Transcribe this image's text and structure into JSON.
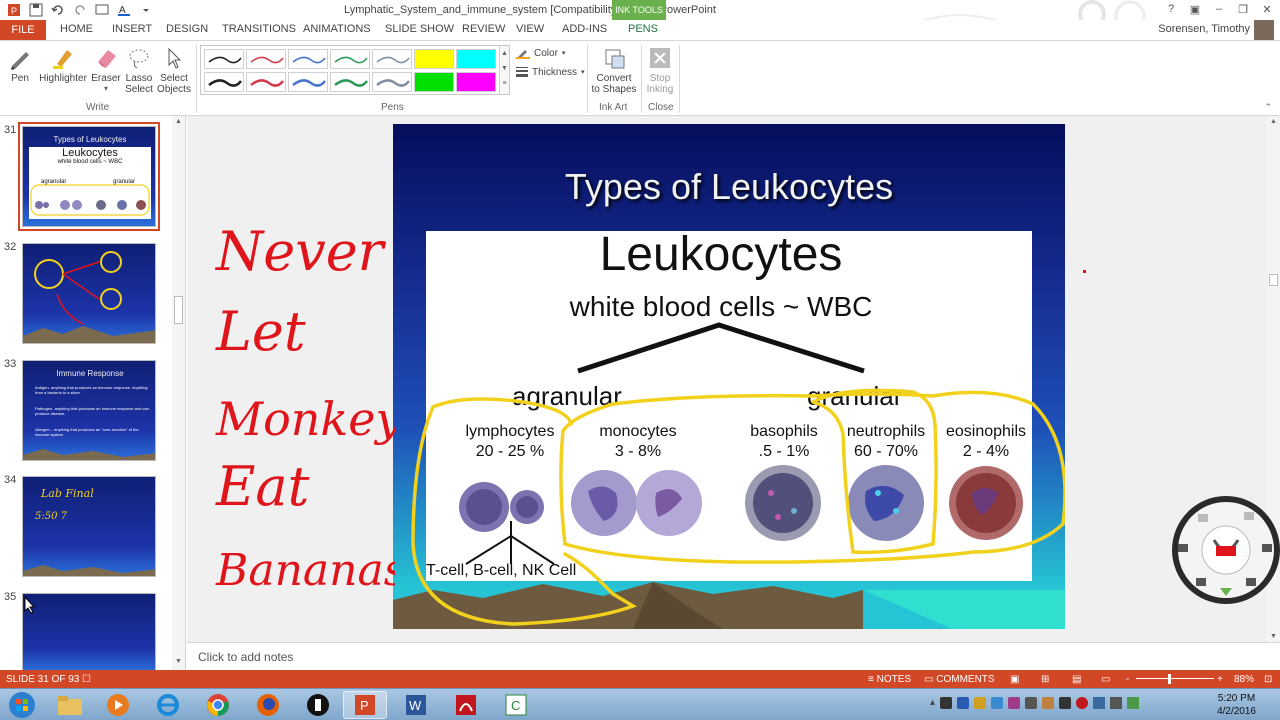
{
  "window": {
    "title": "Lymphatic_System_and_immune_system [Compatibility Mode] - PowerPoint",
    "context_tab_header": "INK TOOLS",
    "user": "Sorensen, Timothy"
  },
  "tabs": [
    "FILE",
    "HOME",
    "INSERT",
    "DESIGN",
    "TRANSITIONS",
    "ANIMATIONS",
    "SLIDE SHOW",
    "REVIEW",
    "VIEW",
    "ADD-INS",
    "PENS"
  ],
  "ribbon": {
    "write": {
      "label": "Write",
      "pen": "Pen",
      "highlighter": "Highlighter",
      "eraser": "Eraser",
      "lasso_1": "Lasso",
      "lasso_2": "Select",
      "select_1": "Select",
      "select_2": "Objects"
    },
    "pens": {
      "label": "Pens",
      "color": "Color",
      "thickness": "Thickness",
      "swatch_colors": [
        "#222222",
        "#d23a4a",
        "#4a74c9",
        "#2d9a5a",
        "#7f8f9f",
        "#ffff00",
        "#00ffff",
        "#222222",
        "#d23a4a",
        "#4a74c9",
        "#2d9a5a",
        "#7f8f9f",
        "#00e000",
        "#ff00ff"
      ]
    },
    "ink_art": {
      "label": "Ink Art",
      "convert_1": "Convert",
      "convert_2": "to Shapes"
    },
    "close": {
      "label": "Close",
      "stop_1": "Stop",
      "stop_2": "Inking"
    }
  },
  "thumbnails": {
    "numbers": [
      "31",
      "32",
      "33",
      "34",
      "35"
    ],
    "t31": {
      "title": "Types of Leukocytes",
      "big": "Leukocytes",
      "sub": "white blood cells ~ WBC",
      "branches": [
        "agranular",
        "granular"
      ]
    },
    "t33": {
      "title": "Immune Response",
      "b1": "Antigen- anything that produces an immune response. Anything from a bacteria to a sliver.",
      "b2": "Pathogen- anything that produces an immune response and can produce disease.",
      "b3": "Allergen – anything that produces an \"over-reaction\" of the immune system"
    },
    "t34": {
      "ink_1": "Lab Final",
      "ink_2": "5:50  7"
    }
  },
  "slide": {
    "title": "Types of Leukocytes",
    "heading": "Leukocytes",
    "subheading": "white blood cells ~ WBC",
    "agranular": "agranular",
    "granular": "granular",
    "cells": [
      {
        "name": "lymphocytes",
        "pct": "20 - 25 %"
      },
      {
        "name": "monocytes",
        "pct": "3 - 8%"
      },
      {
        "name": "basophils",
        "pct": ".5 - 1%"
      },
      {
        "name": "neutrophils",
        "pct": "60 - 70%"
      },
      {
        "name": "eosinophils",
        "pct": "2 - 4%"
      }
    ],
    "lymph_types": "T-cell, B-cell, NK Cell"
  },
  "handwriting": {
    "words": [
      "Never",
      "Let",
      "Monkeys",
      "Eat",
      "Bananas"
    ],
    "ink_color": "#e0151b"
  },
  "notes_placeholder": "Click to add notes",
  "status": {
    "slide_position": "SLIDE 31 OF 93",
    "notes": "NOTES",
    "comments": "COMMENTS",
    "zoom_minus": "-",
    "zoom_plus": "+",
    "zoom": "88%"
  },
  "taskbar": {
    "time": "5:20 PM",
    "date": "4/2/2016"
  },
  "colors": {
    "accent": "#d24726",
    "ink_tools": "#6ab04c",
    "highlighter_yellow": "#f2d11c"
  }
}
